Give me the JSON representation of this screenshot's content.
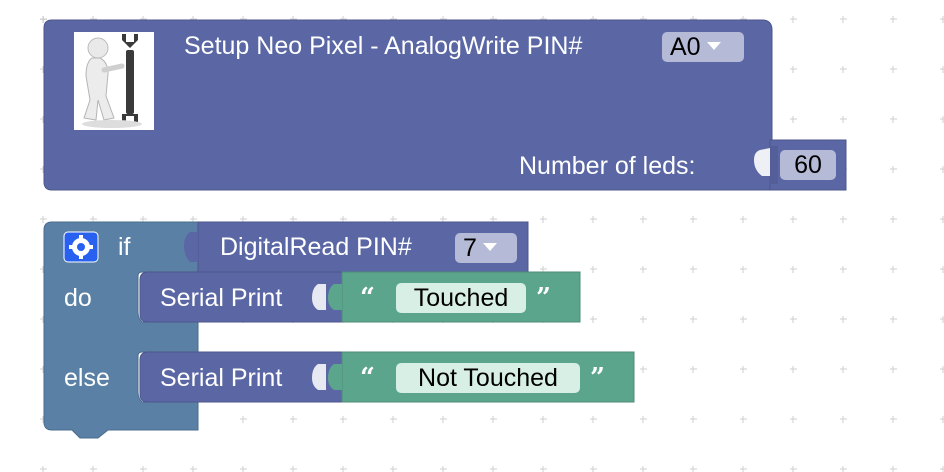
{
  "setup_block": {
    "title": "Setup Neo Pixel - AnalogWrite PIN#",
    "pin_value": "A0",
    "leds_label": "Number of leds:",
    "leds_value": "60",
    "icon": "mechanic-with-wrench-icon"
  },
  "if_block": {
    "if_label": "if",
    "do_label": "do",
    "else_label": "else",
    "condition": {
      "label": "DigitalRead PIN#",
      "pin_value": "7"
    },
    "do_statement": {
      "label": "Serial Print",
      "text": "Touched",
      "open_quote": "“",
      "close_quote": "”"
    },
    "else_statement": {
      "label": "Serial Print",
      "text": "Not Touched",
      "open_quote": "“",
      "close_quote": "”"
    }
  },
  "colors": {
    "procedure_block": "#5b67a5",
    "logic_block": "#5b80a5",
    "text_block": "#5ba58c",
    "mutator_icon": "#2860f0"
  }
}
